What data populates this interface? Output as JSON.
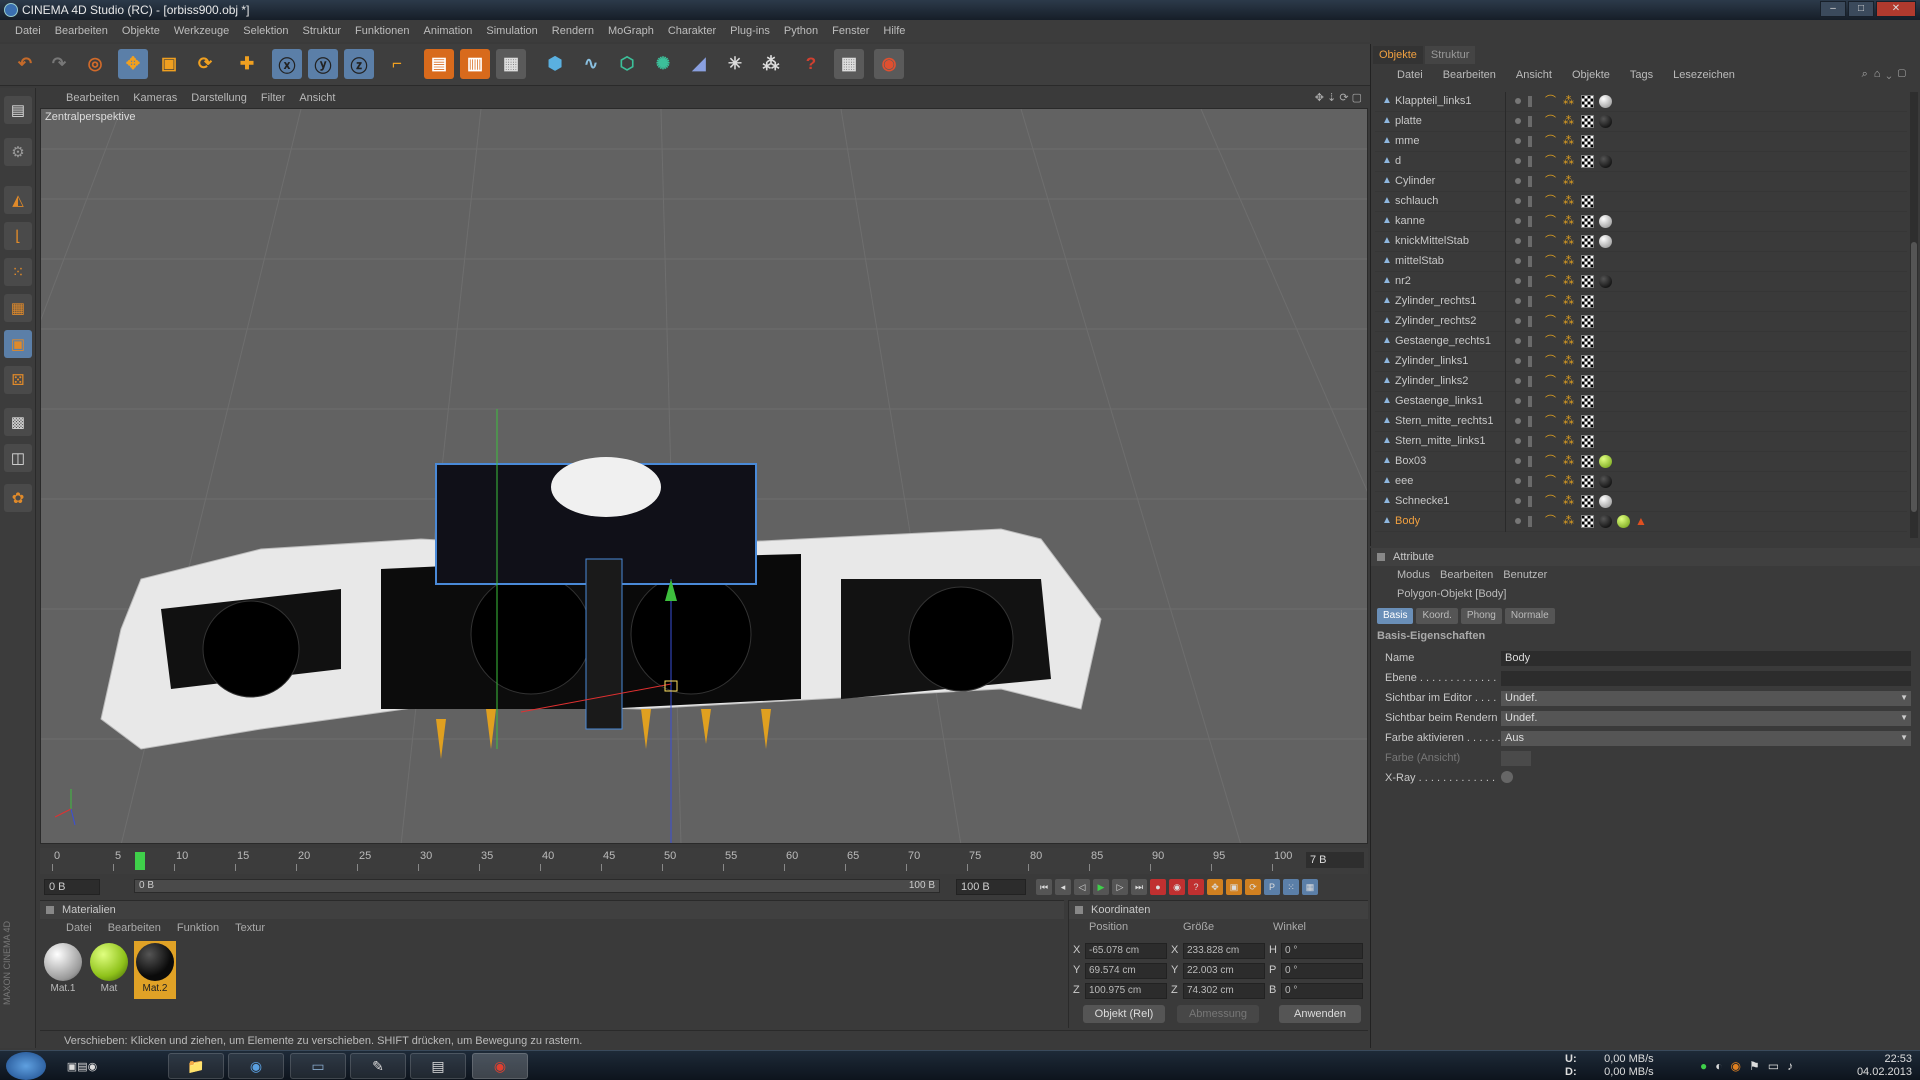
{
  "window": {
    "title": "CINEMA 4D Studio (RC) - [orbiss900.obj *]",
    "btn_min": "–",
    "btn_max": "□",
    "btn_close": "✕"
  },
  "menu": [
    "Datei",
    "Bearbeiten",
    "Objekte",
    "Werkzeuge",
    "Selektion",
    "Struktur",
    "Funktionen",
    "Animation",
    "Simulation",
    "Rendern",
    "MoGraph",
    "Charakter",
    "Plug-ins",
    "Python",
    "Fenster",
    "Hilfe"
  ],
  "toolbar_icons": [
    "undo-icon",
    "redo-icon",
    "live-select-icon",
    "move-icon",
    "scale-icon",
    "rotate-icon",
    "add-icon",
    "x-axis-icon",
    "y-axis-icon",
    "z-axis-icon",
    "coordinate-system-icon",
    "render-view-icon",
    "render-picture-viewer-icon",
    "edit-render-settings-icon",
    "cube-icon",
    "spline-icon",
    "nurbs-icon",
    "array-icon",
    "deformer-icon",
    "scene-icon",
    "environment-icon",
    "camera-icon",
    "help-icon",
    "layout-icon",
    "snap-icon"
  ],
  "viewport": {
    "menu": [
      "Bearbeiten",
      "Kameras",
      "Darstellung",
      "Filter",
      "Ansicht"
    ],
    "label": "Zentralperspektive",
    "nav": "✥ ⇣ ⟳ ▢"
  },
  "timeline": {
    "ticks": [
      "0",
      "5",
      "10",
      "15",
      "20",
      "25",
      "30",
      "35",
      "40",
      "45",
      "50",
      "55",
      "60",
      "65",
      "70",
      "75",
      "80",
      "85",
      "90",
      "95",
      "100"
    ],
    "current_frame": "7 B",
    "playhead": 7
  },
  "transport": {
    "start": "0 B",
    "slider_left": "0 B",
    "slider_right": "100 B",
    "end": "100 B"
  },
  "materials": {
    "title": "Materialien",
    "menu": [
      "Datei",
      "Bearbeiten",
      "Funktion",
      "Textur"
    ],
    "items": [
      {
        "name": "Mat.1",
        "color": "#e8e8e8"
      },
      {
        "name": "Mat",
        "color": "#8fc21a"
      },
      {
        "name": "Mat.2",
        "color": "#0a0a0a"
      }
    ]
  },
  "coordinates": {
    "title": "Koordinaten",
    "headers": [
      "Position",
      "Größe",
      "Winkel"
    ],
    "rows": [
      {
        "axis": "X",
        "pos": "-65.078 cm",
        "size_axis": "X",
        "size": "233.828 cm",
        "ang_axis": "H",
        "ang": "0 °"
      },
      {
        "axis": "Y",
        "pos": "69.574 cm",
        "size_axis": "Y",
        "size": "22.003 cm",
        "ang_axis": "P",
        "ang": "0 °"
      },
      {
        "axis": "Z",
        "pos": "100.975 cm",
        "size_axis": "Z",
        "size": "74.302 cm",
        "ang_axis": "B",
        "ang": "0 °"
      }
    ],
    "mode": "Objekt (Rel)",
    "size_mode": "Abmessung",
    "apply": "Anwenden"
  },
  "status": "Verschieben: Klicken und ziehen, um Elemente zu verschieben. SHIFT drücken, um Bewegung zu rastern.",
  "objects_panel": {
    "tabs": [
      "Objekte",
      "Struktur"
    ],
    "menu": [
      "Datei",
      "Bearbeiten",
      "Ansicht",
      "Objekte",
      "Tags",
      "Lesezeichen"
    ],
    "items": [
      {
        "name": "Klappteil_links1",
        "tags": [
          "chk",
          "white"
        ]
      },
      {
        "name": "platte",
        "tags": [
          "chk",
          "black"
        ]
      },
      {
        "name": "mme",
        "tags": [
          "chk"
        ]
      },
      {
        "name": "d",
        "tags": [
          "chk",
          "black"
        ]
      },
      {
        "name": "Cylinder",
        "tags": []
      },
      {
        "name": "schlauch",
        "tags": [
          "chk"
        ]
      },
      {
        "name": "kanne",
        "tags": [
          "chk",
          "white"
        ]
      },
      {
        "name": "knickMittelStab",
        "tags": [
          "chk",
          "white"
        ]
      },
      {
        "name": "mittelStab",
        "tags": [
          "chk"
        ]
      },
      {
        "name": "nr2",
        "tags": [
          "chk",
          "black"
        ]
      },
      {
        "name": "Zylinder_rechts1",
        "tags": [
          "chk"
        ]
      },
      {
        "name": "Zylinder_rechts2",
        "tags": [
          "chk"
        ]
      },
      {
        "name": "Gestaenge_rechts1",
        "tags": [
          "chk"
        ]
      },
      {
        "name": "Zylinder_links1",
        "tags": [
          "chk"
        ]
      },
      {
        "name": "Zylinder_links2",
        "tags": [
          "chk"
        ]
      },
      {
        "name": "Gestaenge_links1",
        "tags": [
          "chk"
        ]
      },
      {
        "name": "Stern_mitte_rechts1",
        "tags": [
          "chk"
        ]
      },
      {
        "name": "Stern_mitte_links1",
        "tags": [
          "chk"
        ]
      },
      {
        "name": "Box03",
        "tags": [
          "chk",
          "green"
        ]
      },
      {
        "name": "eee",
        "tags": [
          "chk",
          "black"
        ]
      },
      {
        "name": "Schnecke1",
        "tags": [
          "chk",
          "white"
        ]
      },
      {
        "name": "Body",
        "tags": [
          "chk",
          "black",
          "green",
          "warn"
        ],
        "selected": true
      }
    ]
  },
  "attributes": {
    "title": "Attribute",
    "menu": [
      "Modus",
      "Bearbeiten",
      "Benutzer"
    ],
    "object": "Polygon-Objekt [Body]",
    "tabs": [
      "Basis",
      "Koord.",
      "Phong",
      "Normale"
    ],
    "section": "Basis-Eigenschaften",
    "fields": [
      {
        "label": "Name",
        "value": "Body"
      },
      {
        "label": "Ebene . . . . . . . . . . . . .",
        "value": ""
      },
      {
        "label": "Sichtbar im Editor . . . .",
        "value": "Undef."
      },
      {
        "label": "Sichtbar beim Rendern",
        "value": "Undef."
      },
      {
        "label": "Farbe aktivieren . . . . . .",
        "value": "Aus"
      },
      {
        "label": "Farbe (Ansicht)",
        "value": ""
      },
      {
        "label": "X-Ray . . . . . . . . . . . . .",
        "value": ""
      }
    ]
  },
  "taskbar": {
    "net_up_label": "U:",
    "net_up": "0,00 MB/s",
    "net_down_label": "D:",
    "net_down": "0,00 MB/s",
    "time": "22:53",
    "date": "04.02.2013"
  },
  "colors": {
    "accent": "#5b7fa8",
    "selection": "#f0a040",
    "viewport": "#626262"
  }
}
